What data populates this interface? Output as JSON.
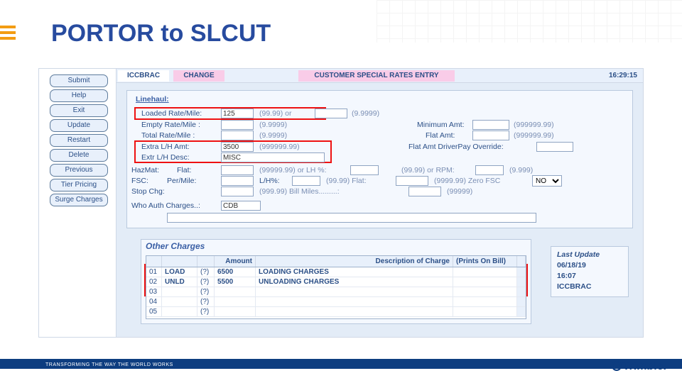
{
  "slide": {
    "title": "PORTOR to SLCUT",
    "footer": "TRANSFORMING THE WAY THE WORLD WORKS",
    "brand": "Trimble"
  },
  "side": [
    "Submit",
    "Help",
    "Exit",
    "Update",
    "Restart",
    "Delete",
    "Previous",
    "Tier Pricing",
    "Surge Charges"
  ],
  "hdr": {
    "module": "ICCBRAC",
    "mode": "CHANGE",
    "screen": "CUSTOMER SPECIAL RATES ENTRY",
    "time": "16:29:15"
  },
  "linehaul": {
    "legend": "Linehaul:",
    "loaded_lbl": "Loaded Rate/Mile:",
    "loaded_val": "125",
    "loaded_hint1": "(99.99)  or",
    "loaded_hint2": "(9.9999)",
    "empty_lbl": "Empty Rate/Mile :",
    "empty_hint": "(9.9999)",
    "total_lbl": "Total Rate/Mile :",
    "total_hint": "(9.9999)",
    "min_lbl": "Minimum Amt:",
    "min_hint": "(999999.99)",
    "flatamt_lbl": "Flat Amt:",
    "flatamt_hint": "(999999.99)",
    "extra_lbl": "Extra L/H Amt:",
    "extra_val": "3500",
    "extra_hint": "(999999.99)",
    "desc_lbl": "Extr L/H Desc:",
    "desc_val": "MISC",
    "flatdp_lbl": "Flat Amt DriverPay Override:",
    "hazmat_lbl": "HazMat:",
    "flat_lbl": "Flat:",
    "haz_hint": "(99999.99) or LH %:",
    "haz_hint2": "(99.99) or RPM:",
    "haz_hint3": "(9.999)",
    "fsc_lbl": "FSC:",
    "permile_lbl": "Per/Mile:",
    "lh_lbl": "L/H%:",
    "lh_hint": "(99.99) Flat:",
    "lh_hint2": "(9999.99) Zero FSC",
    "zero_sel": "NO",
    "stop_lbl": "Stop Chg:",
    "stop_hint": "(999.99)  Bill Miles.........:",
    "stop_hint2": "(99999)",
    "auth_lbl": "Who Auth Charges..:",
    "auth_val": "CDB"
  },
  "other": {
    "title": "Other Charges",
    "cols": {
      "amount": "Amount",
      "desc": "Description of Charge",
      "prints": "(Prints On Bill)"
    },
    "rows": [
      {
        "n": "01",
        "code": "LOAD",
        "q": "(?)",
        "amt": "6500",
        "desc": "LOADING CHARGES"
      },
      {
        "n": "02",
        "code": "UNLD",
        "q": "(?)",
        "amt": "5500",
        "desc": "UNLOADING CHARGES"
      },
      {
        "n": "03",
        "code": "",
        "q": "(?)",
        "amt": "",
        "desc": ""
      },
      {
        "n": "04",
        "code": "",
        "q": "(?)",
        "amt": "",
        "desc": ""
      },
      {
        "n": "05",
        "code": "",
        "q": "(?)",
        "amt": "",
        "desc": ""
      }
    ]
  },
  "last": {
    "title": "Last Update",
    "date": "06/18/19",
    "time": "16:07",
    "user": "ICCBRAC"
  }
}
